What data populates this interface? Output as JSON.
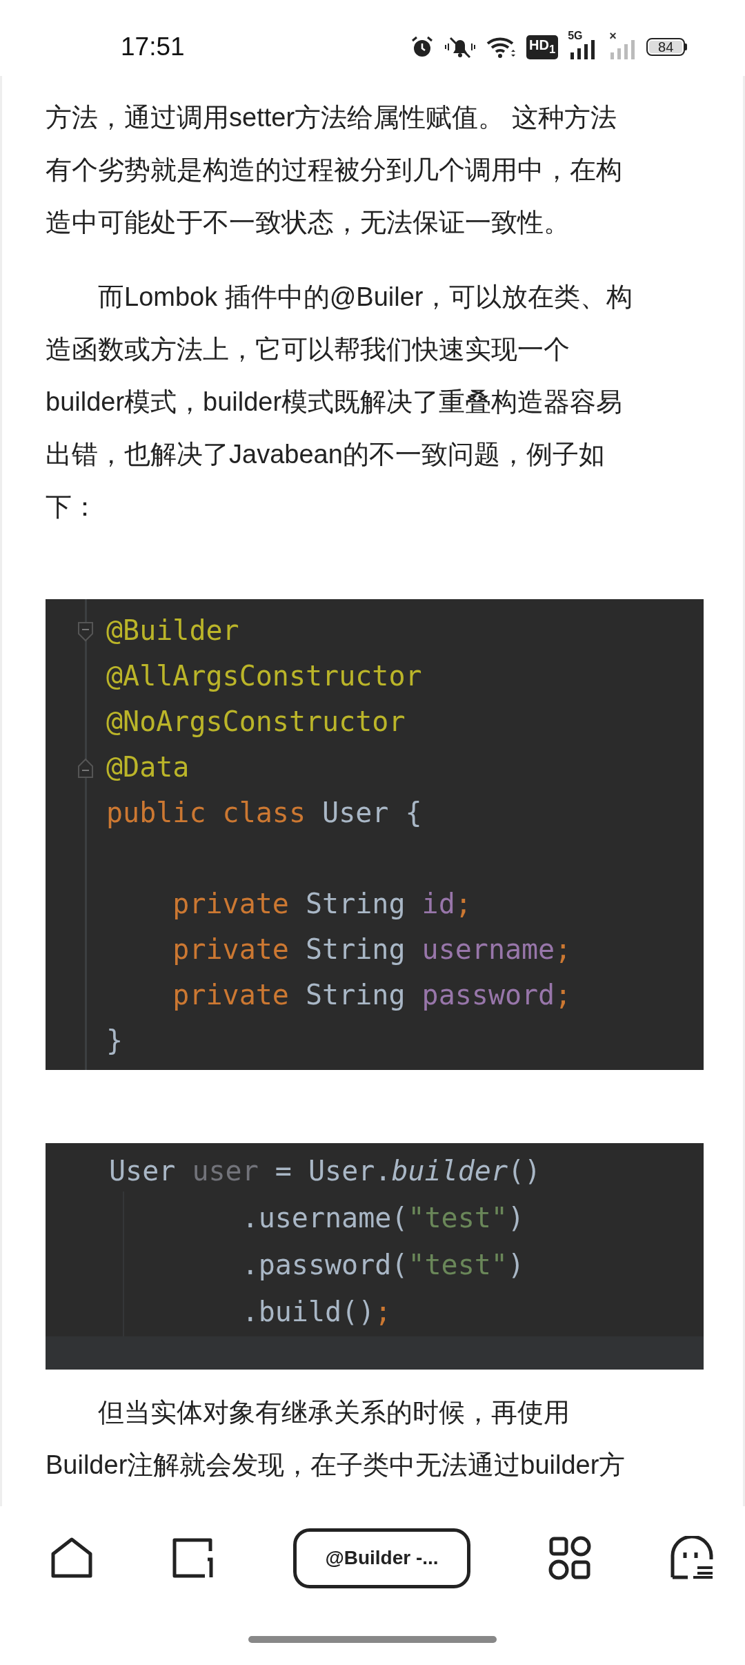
{
  "status_bar": {
    "time": "17:51",
    "hd_badge": "HD$_{1}$",
    "sim1_label": "5G",
    "sim2_label": "×",
    "battery": "84"
  },
  "article": [
    {
      "kind": "paragraph",
      "indented": false,
      "lines": [
        "方法，通过调用setter方法给属性赋值。 这种方法",
        "有个劣势就是构造的过程被分到几个调用中，在构",
        "造中可能处于不一致状态，无法保证一致性。"
      ]
    },
    {
      "kind": "paragraph",
      "indented": true,
      "lines": [
        "而Lombok 插件中的@Builer，可以放在类、构",
        "造函数或方法上，它可以帮我们快速实现一个",
        "builder模式，builder模式既解决了重叠构造器容易",
        "出错，也解决了Javabean的不一致问题，例子如",
        "下："
      ]
    },
    {
      "kind": "code",
      "lines": [
        {
          "kind": "fold-start",
          "tokens": [
            {
              "kind": "annotation",
              "text": "@Builder"
            }
          ]
        },
        {
          "kind": "plain",
          "tokens": [
            {
              "kind": "annotation",
              "text": "@AllArgsConstructor"
            }
          ]
        },
        {
          "kind": "plain",
          "tokens": [
            {
              "kind": "annotation",
              "text": "@NoArgsConstructor"
            }
          ]
        },
        {
          "kind": "fold-end",
          "tokens": [
            {
              "kind": "annotation",
              "text": "@Data"
            }
          ]
        },
        {
          "kind": "plain",
          "tokens": [
            {
              "kind": "keyword",
              "text": "public class "
            },
            {
              "kind": "plain",
              "text": "User {"
            }
          ],
          "children": [
            {
              "kind": "blank"
            },
            {
              "kind": "plain",
              "tokens": [
                {
                  "kind": "keyword",
                  "text": "private "
                },
                {
                  "kind": "plain",
                  "text": "String "
                },
                {
                  "kind": "field",
                  "text": "id"
                },
                {
                  "kind": "keyword",
                  "text": ";"
                }
              ]
            },
            {
              "kind": "plain",
              "tokens": [
                {
                  "kind": "keyword",
                  "text": "private "
                },
                {
                  "kind": "plain",
                  "text": "String "
                },
                {
                  "kind": "field",
                  "text": "username"
                },
                {
                  "kind": "keyword",
                  "text": ";"
                }
              ]
            },
            {
              "kind": "plain",
              "tokens": [
                {
                  "kind": "keyword",
                  "text": "private "
                },
                {
                  "kind": "plain",
                  "text": "String "
                },
                {
                  "kind": "field",
                  "text": "password"
                },
                {
                  "kind": "keyword",
                  "text": ";"
                }
              ]
            }
          ]
        },
        {
          "kind": "plain",
          "tokens": [
            {
              "kind": "plain",
              "text": "}"
            }
          ]
        }
      ]
    },
    {
      "kind": "code",
      "lines": [
        {
          "kind": "plain",
          "tokens": [
            {
              "kind": "plain",
              "text": "User "
            },
            {
              "kind": "muted",
              "text": "user"
            },
            {
              "kind": "plain",
              "text": " = User."
            },
            {
              "kind": "method",
              "text": "builder"
            },
            {
              "kind": "plain",
              "text": "()"
            }
          ],
          "children": [
            {
              "kind": "plain",
              "tokens": [
                {
                  "kind": "plain",
                  "text": ".username("
                },
                {
                  "kind": "string",
                  "text": "\"test\""
                },
                {
                  "kind": "plain",
                  "text": ")"
                }
              ]
            },
            {
              "kind": "plain",
              "tokens": [
                {
                  "kind": "plain",
                  "text": ".password("
                },
                {
                  "kind": "string",
                  "text": "\"test\""
                },
                {
                  "kind": "plain",
                  "text": ")"
                }
              ]
            },
            {
              "kind": "plain",
              "tokens": [
                {
                  "kind": "plain",
                  "text": ".build()"
                },
                {
                  "kind": "keyword",
                  "text": ";"
                }
              ]
            }
          ]
        }
      ]
    },
    {
      "kind": "paragraph",
      "indented": true,
      "lines": [
        "但当实体对象有继承关系的时候，再使用",
        "Builder注解就会发现，在子类中无法通过builder方"
      ]
    }
  ],
  "bottom_nav": {
    "tab_title": "@Builder -..."
  }
}
